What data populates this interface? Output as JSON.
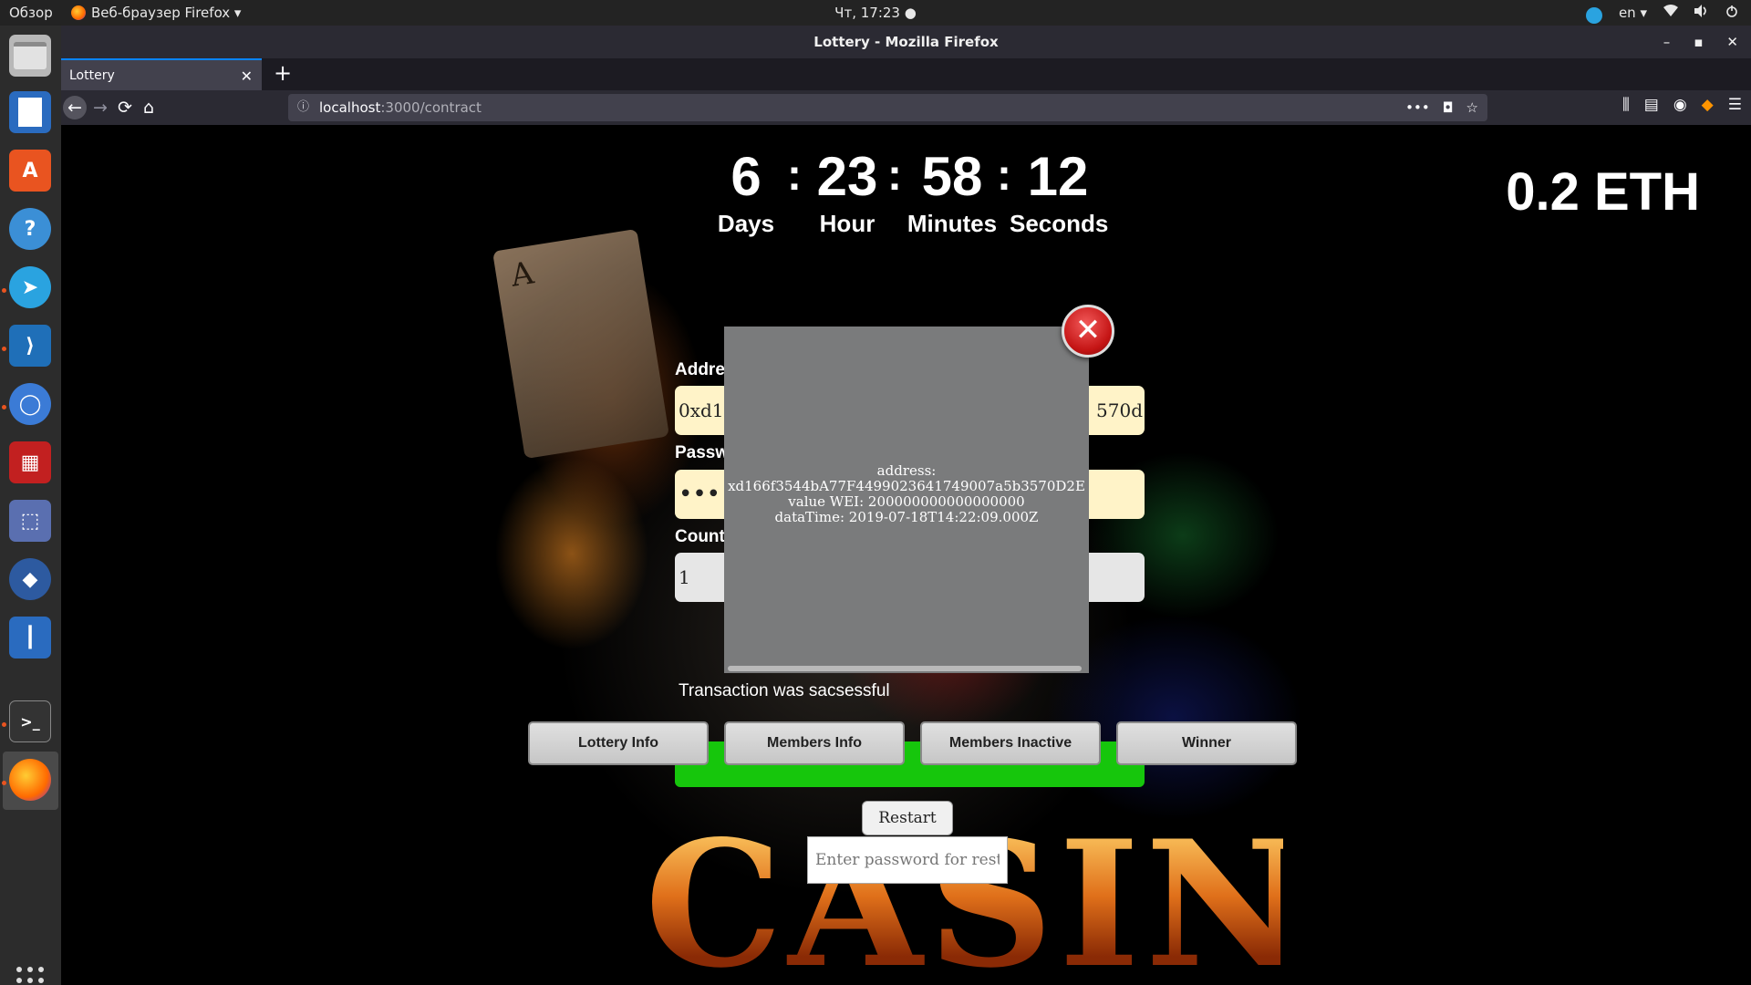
{
  "topbar": {
    "activities": "Обзор",
    "app_menu": "Веб-браузер Firefox ▾",
    "clock": "Чт, 17:23 ●",
    "lang": "en ▾",
    "wifi_icon": "wifi-icon",
    "volume_icon": "volume-icon",
    "power_icon": "power-icon"
  },
  "dock": {
    "items": [
      "files-icon",
      "writer-icon",
      "software-icon",
      "help-icon",
      "telegram-icon",
      "vscode-icon",
      "chromium-icon",
      "app-icon",
      "screenshot-icon",
      "ethereum-icon",
      "ruler-icon",
      "terminal-icon",
      "firefox-icon"
    ]
  },
  "window": {
    "title": "Lottery - Mozilla Firefox",
    "minimize": "–",
    "maximize": "▪",
    "close": "✕"
  },
  "tab": {
    "label": "Lottery",
    "close": "✕",
    "new_tab": "+"
  },
  "nav": {
    "back": "←",
    "forward": "→",
    "reload": "⟳",
    "home": "⌂",
    "url_info": "ⓘ",
    "url_host": "localhost",
    "url_path": ":3000/contract",
    "more": "•••",
    "pocket": "◘",
    "bookmark": "☆",
    "library": "⫼",
    "sidebar": "▤",
    "account": "◉",
    "ext": "◆",
    "menu": "☰"
  },
  "countdown": {
    "days": "6",
    "days_label": "Days",
    "hours": "23",
    "hours_label": "Hour",
    "minutes": "58",
    "minutes_label": "Minutes",
    "seconds": "12",
    "seconds_label": "Seconds",
    "sep": ":"
  },
  "balance": "0.2 ETH",
  "form": {
    "address_label": "Addre",
    "address_value_start": "0xd1",
    "address_value_end": "570d",
    "password_label": "Passw",
    "password_value": "•••",
    "count_label": "Count",
    "count_value": "1"
  },
  "status": "Transaction was sacsessful",
  "buttons": {
    "lottery_info": "Lottery Info",
    "members_info": "Members Info",
    "members_inactive": "Members Inactive",
    "winner": "Winner",
    "restart": "Restart"
  },
  "restart_placeholder": "Enter password for resta",
  "background_text": "CASINO",
  "card_letter": "A",
  "modal": {
    "close": "✕",
    "line1": "address:",
    "line2": "xd166f3544bA77F4499023641749007a5b3570D2E",
    "line3": "value WEI: 200000000000000000",
    "line4": "dataTime: 2019-07-18T14:22:09.000Z"
  }
}
